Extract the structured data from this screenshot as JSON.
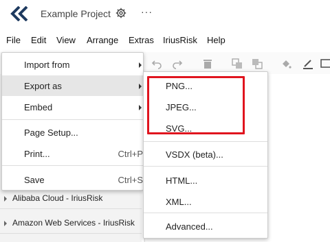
{
  "window": {
    "project_title": "Example Project",
    "more_label": "···"
  },
  "menubar": {
    "items": [
      "File",
      "Edit",
      "View",
      "Arrange",
      "Extras",
      "IriusRisk",
      "Help"
    ]
  },
  "file_menu": {
    "import_from": "Import from",
    "export_as": "Export as",
    "embed": "Embed",
    "page_setup": "Page Setup...",
    "print": "Print...",
    "print_shortcut": "Ctrl+P",
    "save": "Save",
    "save_shortcut": "Ctrl+S"
  },
  "export_submenu": {
    "png": "PNG...",
    "jpeg": "JPEG...",
    "svg": "SVG...",
    "vsdx": "VSDX (beta)...",
    "html": "HTML...",
    "xml": "XML...",
    "advanced": "Advanced..."
  },
  "sidebar": {
    "libraries": [
      "Alibaba Cloud - IriusRisk",
      "Amazon Web Services - IriusRisk"
    ]
  },
  "colors": {
    "highlight": "#e0141e",
    "logo": "#1e3a5f",
    "hover": "#e6e6e6"
  }
}
